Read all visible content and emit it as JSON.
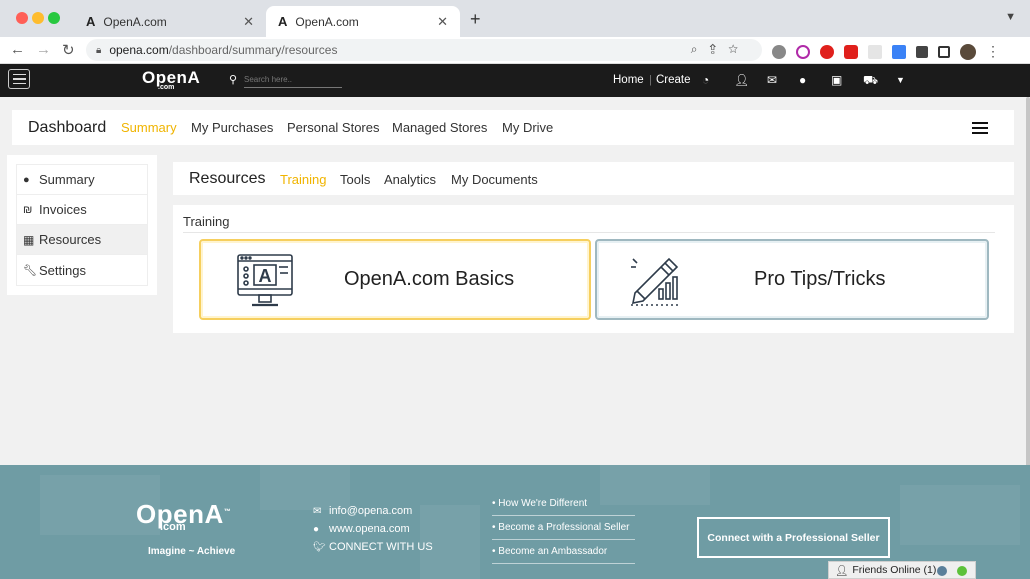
{
  "browser": {
    "tabs": [
      {
        "title": "OpenA.com",
        "logo": "A",
        "active": false
      },
      {
        "title": "OpenA.com",
        "logo": "A",
        "active": true
      }
    ],
    "new_tab_icon": "+",
    "tab_menu_icon": "chevron-down-icon",
    "url_domain": "opena.com",
    "url_path": "/dashboard/summary/resources",
    "colors": {
      "red": "#ff5f57",
      "yellow": "#febc2e",
      "green": "#28c840"
    }
  },
  "site_header": {
    "logo": "OpenA",
    "logo_sub": ".com",
    "search_placeholder": "Search here..",
    "links": [
      "Home",
      "Create"
    ]
  },
  "dashboard_nav": {
    "title": "Dashboard",
    "tabs": [
      {
        "label": "Summary",
        "active": true
      },
      {
        "label": "My Purchases",
        "active": false
      },
      {
        "label": "Personal Stores",
        "active": false
      },
      {
        "label": "Managed Stores",
        "active": false
      },
      {
        "label": "My Drive",
        "active": false
      }
    ],
    "accent": "#f0b400"
  },
  "sidebar": {
    "items": [
      {
        "label": "Summary",
        "icon": "globe-icon",
        "active": false
      },
      {
        "label": "Invoices",
        "icon": "shekel-icon",
        "active": false
      },
      {
        "label": "Resources",
        "icon": "grid-icon",
        "active": true
      },
      {
        "label": "Settings",
        "icon": "wrench-icon",
        "active": false
      }
    ]
  },
  "resources": {
    "title": "Resources",
    "tabs": [
      {
        "label": "Training",
        "active": true
      },
      {
        "label": "Tools",
        "active": false
      },
      {
        "label": "Analytics",
        "active": false
      },
      {
        "label": "My Documents",
        "active": false
      }
    ],
    "section_label": "Training",
    "cards": [
      {
        "label": "OpenA.com Basics",
        "icon": "monitor-icon",
        "border": "#f6cf5e"
      },
      {
        "label": "Pro Tips/Tricks",
        "icon": "pencil-chart-icon",
        "border": "#9fb8c0"
      }
    ]
  },
  "footer": {
    "logo": "OpenA",
    "logo_tm": "™",
    "logo_sub": ".com",
    "tagline": "Imagine ~ Achieve",
    "contacts": [
      {
        "icon": "mail-icon",
        "text": "info@opena.com"
      },
      {
        "icon": "globe-icon",
        "text": "www.opena.com"
      },
      {
        "icon": "twitter-icon",
        "text": "CONNECT WITH US"
      }
    ],
    "links": [
      "How We're Different",
      "Become a Professional Seller",
      "Become an Ambassador"
    ],
    "cta": "Connect with a Professional Seller",
    "background": "#6f9ca4"
  },
  "friends_bar": {
    "label": "Friends Online (1)"
  }
}
